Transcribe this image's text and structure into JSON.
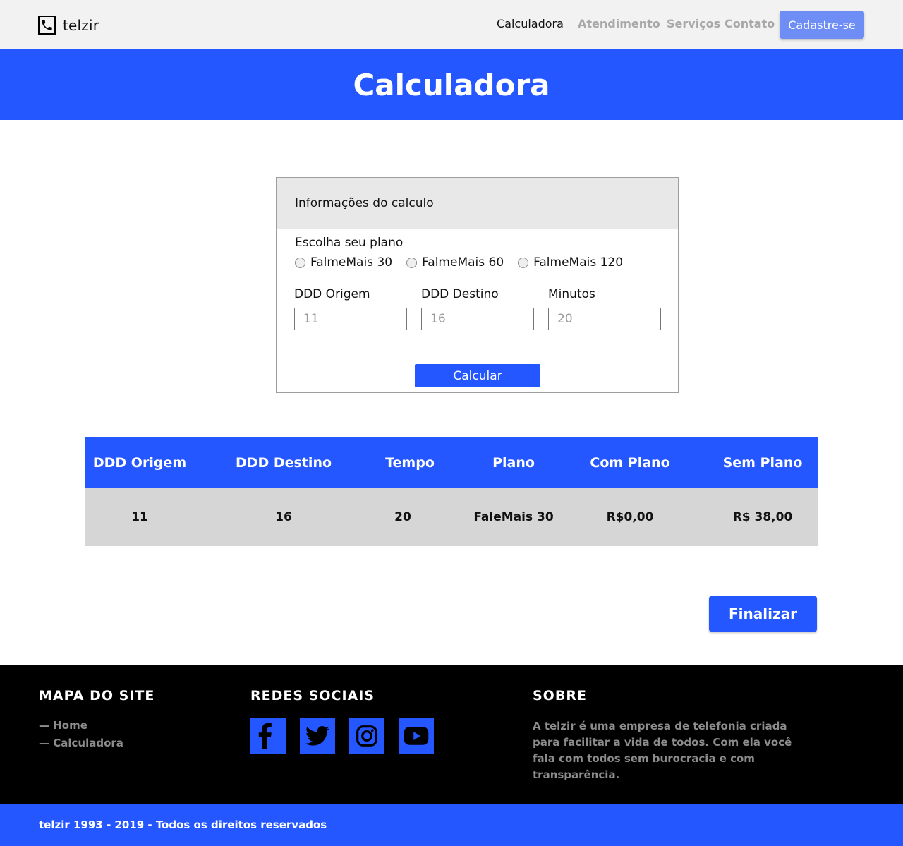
{
  "header": {
    "brand": "telzir",
    "nav": [
      "Calculadora",
      "Atendimento",
      "Serviços",
      "Contato"
    ],
    "active_nav": "Calculadora",
    "signup_label": "Cadastre-se"
  },
  "banner": {
    "title": "Calculadora"
  },
  "calculator": {
    "card_title": "Informações do calculo",
    "plan_label": "Escolha seu plano",
    "plans": [
      "FalmeMais 30",
      "FalmeMais 60",
      "FalmeMais 120"
    ],
    "fields": [
      {
        "label": "DDD Origem",
        "placeholder": "11"
      },
      {
        "label": "DDD Destino",
        "placeholder": "16"
      },
      {
        "label": "Minutos",
        "placeholder": "20"
      }
    ],
    "calc_label": "Calcular"
  },
  "results": {
    "columns": [
      "DDD Origem",
      "DDD Destino",
      "Tempo",
      "Plano",
      "Com Plano",
      "Sem Plano"
    ],
    "rows": [
      [
        "11",
        "16",
        "20",
        "FaleMais 30",
        "R$0,00",
        "R$ 38,00"
      ]
    ]
  },
  "finish_label": "Finalizar",
  "footer": {
    "sitemap_heading": "MAPA DO SITE",
    "sitemap_links": [
      "— Home",
      "— Calculadora"
    ],
    "social_heading": "REDES SOCIAIS",
    "social_icons": [
      "facebook-icon",
      "twitter-icon",
      "instagram-icon",
      "youtube-icon"
    ],
    "about_heading": "SOBRE",
    "about_text": "A telzir é uma empresa de telefonia criada para facilitar a vida de todos. Com ela você fala com todos sem burocracia e com transparência.",
    "copyright": "telzir 1993 - 2019 - Todos os direitos reservados"
  },
  "colors": {
    "brand_blue": "#2457ff",
    "signup_blue": "#6e8ef5",
    "header_bg": "#f2f2f2",
    "row_bg": "#d6d6d6",
    "footer_bg": "#000000"
  }
}
